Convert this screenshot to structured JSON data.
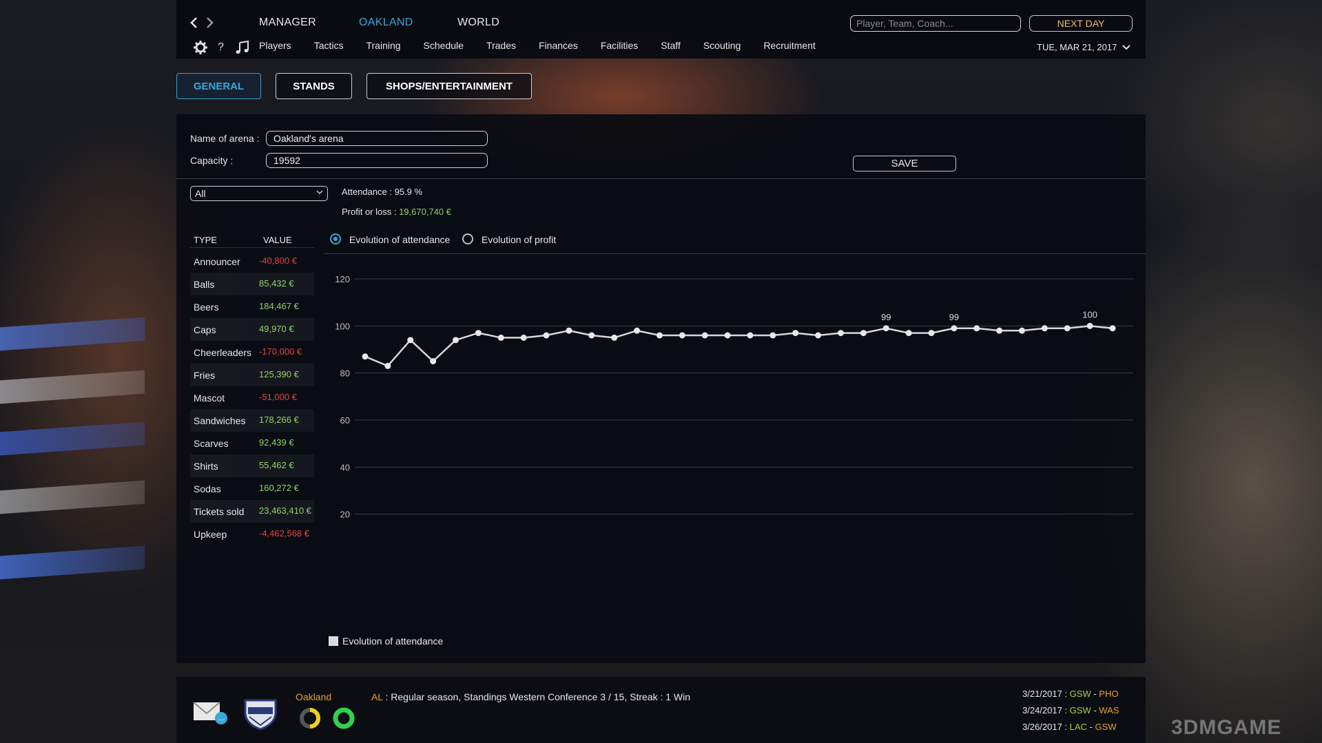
{
  "nav": {
    "tabs": [
      {
        "label": "MANAGER"
      },
      {
        "label": "OAKLAND"
      },
      {
        "label": "WORLD"
      }
    ],
    "search_placeholder": "Player, Team, Coach...",
    "next_day": "NEXT DAY",
    "date": "TUE, MAR 21, 2017",
    "help": "?",
    "subnav": [
      "Players",
      "Tactics",
      "Training",
      "Schedule",
      "Trades",
      "Finances",
      "Facilities",
      "Staff",
      "Scouting",
      "Recruitment"
    ]
  },
  "subtabs": [
    "GENERAL",
    "STANDS",
    "SHOPS/ENTERTAINMENT"
  ],
  "arena": {
    "name_label": "Name of arena :",
    "name_value": "Oakland's arena",
    "capacity_label": "Capacity :",
    "capacity_value": "19592",
    "save": "SAVE"
  },
  "filter": "All",
  "summary": {
    "attendance": "Attendance : 95.9 %",
    "profit_label": "Profit or loss : ",
    "profit_value": "19,670,740 €"
  },
  "table": {
    "headers": [
      "TYPE",
      "VALUE"
    ],
    "rows": [
      {
        "type": "Announcer",
        "value": "-40,800 €",
        "negative": true
      },
      {
        "type": "Balls",
        "value": "85,432 €",
        "negative": false
      },
      {
        "type": "Beers",
        "value": "184,467 €",
        "negative": false
      },
      {
        "type": "Caps",
        "value": "49,970 €",
        "negative": false
      },
      {
        "type": "Cheerleaders",
        "value": "-170,000 €",
        "negative": true
      },
      {
        "type": "Fries",
        "value": "125,390 €",
        "negative": false
      },
      {
        "type": "Mascot",
        "value": "-51,000 €",
        "negative": true
      },
      {
        "type": "Sandwiches",
        "value": "178,266 €",
        "negative": false
      },
      {
        "type": "Scarves",
        "value": "92,439 €",
        "negative": false
      },
      {
        "type": "Shirts",
        "value": "55,462 €",
        "negative": false
      },
      {
        "type": "Sodas",
        "value": "160,272 €",
        "negative": false
      },
      {
        "type": "Tickets sold",
        "value": "23,463,410 €",
        "negative": false
      },
      {
        "type": "Upkeep",
        "value": "-4,462,568 €",
        "negative": true
      }
    ]
  },
  "radio": {
    "attendance": "Evolution of attendance",
    "profit": "Evolution of profit"
  },
  "chart_data": {
    "type": "line",
    "ylim": [
      20,
      120
    ],
    "yticks": [
      120,
      100,
      80,
      60,
      40,
      20
    ],
    "grid": true,
    "series": [
      {
        "name": "Evolution of attendance",
        "values": [
          87,
          83,
          94,
          85,
          94,
          97,
          95,
          95,
          96,
          98,
          96,
          95,
          98,
          96,
          96,
          96,
          96,
          96,
          96,
          97,
          96,
          97,
          97,
          99,
          97,
          97,
          99,
          99,
          98,
          98,
          99,
          99,
          100,
          99
        ]
      }
    ],
    "annotations": [
      {
        "index": 23,
        "label": "99"
      },
      {
        "index": 26,
        "label": "99"
      },
      {
        "index": 32,
        "label": "100"
      }
    ],
    "legend": "bottom-left"
  },
  "colors": {
    "accent": "#3aa8d8",
    "positive": "#8ed26a",
    "negative": "#e04444",
    "orange": "#e8a030",
    "green": "#a8d040"
  },
  "bottom": {
    "team": "Oakland",
    "league_tag": "AL",
    "status": " : Regular season, Standings Western Conference 3 / 15, Streak : 1 Win",
    "games": [
      {
        "date": "3/21/2017 : ",
        "home": "GSW",
        "sep": " - ",
        "away": "PHO"
      },
      {
        "date": "3/24/2017 : ",
        "home": "GSW",
        "sep": " - ",
        "away": "WAS"
      },
      {
        "date": "3/26/2017 : ",
        "home": "LAC",
        "sep": " - ",
        "away": "GSW"
      }
    ],
    "watermark": "3DMGAME"
  }
}
